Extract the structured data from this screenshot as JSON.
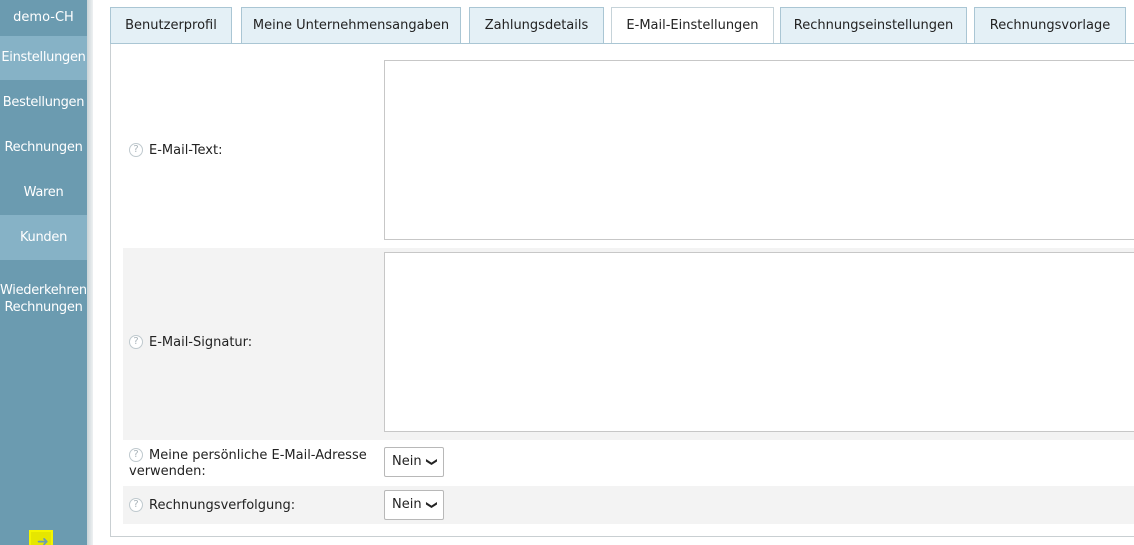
{
  "sidebar": {
    "brand": "demo-CH",
    "items": [
      {
        "label": "Einstellungen",
        "active": true
      },
      {
        "label": "Bestellungen"
      },
      {
        "label": "Rechnungen"
      },
      {
        "label": "Waren"
      },
      {
        "label": "Kunden",
        "active": true
      },
      {
        "label_line1": "Wiederkehrende",
        "label_line2": "Rechnungen"
      }
    ],
    "exit_icon": "exit-icon"
  },
  "tabs": [
    {
      "label": "Benutzerprofil"
    },
    {
      "label": "Meine Unternehmensangaben"
    },
    {
      "label": "Zahlungsdetails"
    },
    {
      "label": "E-Mail-Einstellungen",
      "active": true
    },
    {
      "label": "Rechnungseinstellungen"
    },
    {
      "label": "Rechnungsvorlage"
    }
  ],
  "form": {
    "email_text_label": "E-Mail-Text:",
    "email_text_value": "",
    "email_signature_label": "E-Mail-Signatur:",
    "email_signature_value": "",
    "personal_email_label_line1": "Meine persönliche E-Mail-Adresse",
    "personal_email_label_line2": "verwenden:",
    "personal_email_value": "Nein",
    "tracking_label": "Rechnungsverfolgung:",
    "tracking_value": "Nein",
    "help_glyph": "?"
  },
  "colors": {
    "sidebar": "#6b9bb0",
    "sidebar_active": "#86b2c6",
    "tab_bg": "#e4f0f6",
    "row_shade": "#f3f3f3"
  }
}
